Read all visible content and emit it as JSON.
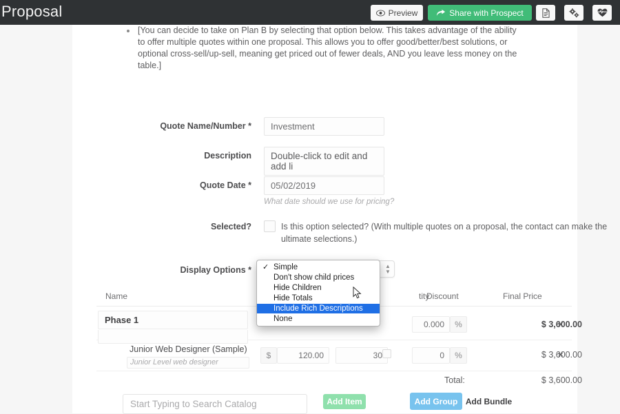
{
  "topbar": {
    "title": "Proposal",
    "preview_label": "Preview",
    "preview_icon": "eye-icon",
    "share_label": "Share with Prospect",
    "share_icon": "share-arrow-icon",
    "doc_icon": "document-icon",
    "settings_icon": "cogs-icon",
    "health_icon": "heart-pulse-icon",
    "share_color": "#41bc78",
    "bar_color": "#2f3234"
  },
  "intro": {
    "text": "[You can decide to take on Plan B by selecting that option below. This takes advantage of the ability to offer multiple quotes within one proposal. This allows you to offer good/better/best solutions, or optional cross-sell/up-sell, meaning get priced out of fewer deals, AND you leave less money on the table.]"
  },
  "form": {
    "quote_name": {
      "label": "Quote Name/Number *",
      "value": "Investment"
    },
    "description": {
      "label": "Description",
      "value": "Double-click to edit and add li"
    },
    "quote_date": {
      "label": "Quote Date *",
      "value": "05/02/2019",
      "help": "What date should we use for pricing?"
    },
    "selected": {
      "label": "Selected?",
      "text": "Is this option selected? (With multiple quotes on a proposal, the contact can make the ultimate selections.)",
      "checked": false
    },
    "display_options": {
      "label": "Display Options *",
      "value": "Simple"
    }
  },
  "dropdown": {
    "open": true,
    "highlight_color": "#1f6fe5",
    "items": [
      {
        "label": "Simple",
        "checked": true,
        "selected": false
      },
      {
        "label": "Don't show child prices",
        "checked": false,
        "selected": false
      },
      {
        "label": "Hide Children",
        "checked": false,
        "selected": false
      },
      {
        "label": "Hide Totals",
        "checked": false,
        "selected": false
      },
      {
        "label": "Include Rich Descriptions",
        "checked": false,
        "selected": true
      },
      {
        "label": "None",
        "checked": false,
        "selected": false
      }
    ]
  },
  "table": {
    "headers": {
      "name": "Name",
      "price": "",
      "quantity": "tity",
      "discount": "Discount",
      "final_price": "Final Price"
    },
    "rows": [
      {
        "type": "group",
        "name": "Phase 1",
        "discount": "0.000",
        "discount_unit": "%",
        "final_price": "$ 3,600.00",
        "remove_label": "×"
      },
      {
        "type": "item",
        "name": "Junior Web Designer (Sample)",
        "description": "Junior Level web designer",
        "currency": "$",
        "price": "120.00",
        "quantity": "30",
        "quantity_checked": false,
        "discount": "0",
        "discount_unit": "%",
        "final_price": "$ 3,600.00",
        "remove_label": "×"
      }
    ],
    "total_label": "Total:",
    "total_value": "$ 3,600.00"
  },
  "footer": {
    "search_placeholder": "Start Typing to Search Catalog",
    "add_item_label": "Add Item",
    "add_item_color": "#8fe0ac",
    "add_group_label": "Add Group",
    "add_group_color": "#78c3ee",
    "add_bundle_label": "Add Bundle"
  }
}
